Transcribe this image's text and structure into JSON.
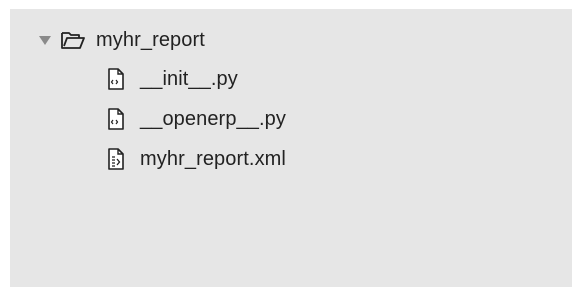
{
  "tree": {
    "root": {
      "name": "myhr_report",
      "expanded": true,
      "icon": "folder-open-icon"
    },
    "children": [
      {
        "name": "__init__.py",
        "icon": "python-file-icon"
      },
      {
        "name": "__openerp__.py",
        "icon": "python-file-icon"
      },
      {
        "name": "myhr_report.xml",
        "icon": "xml-file-icon"
      }
    ]
  },
  "colors": {
    "panel_background": "#e6e6e6",
    "text": "#222222",
    "twisty": "#8a8a8a",
    "icon_stroke": "#222222"
  }
}
